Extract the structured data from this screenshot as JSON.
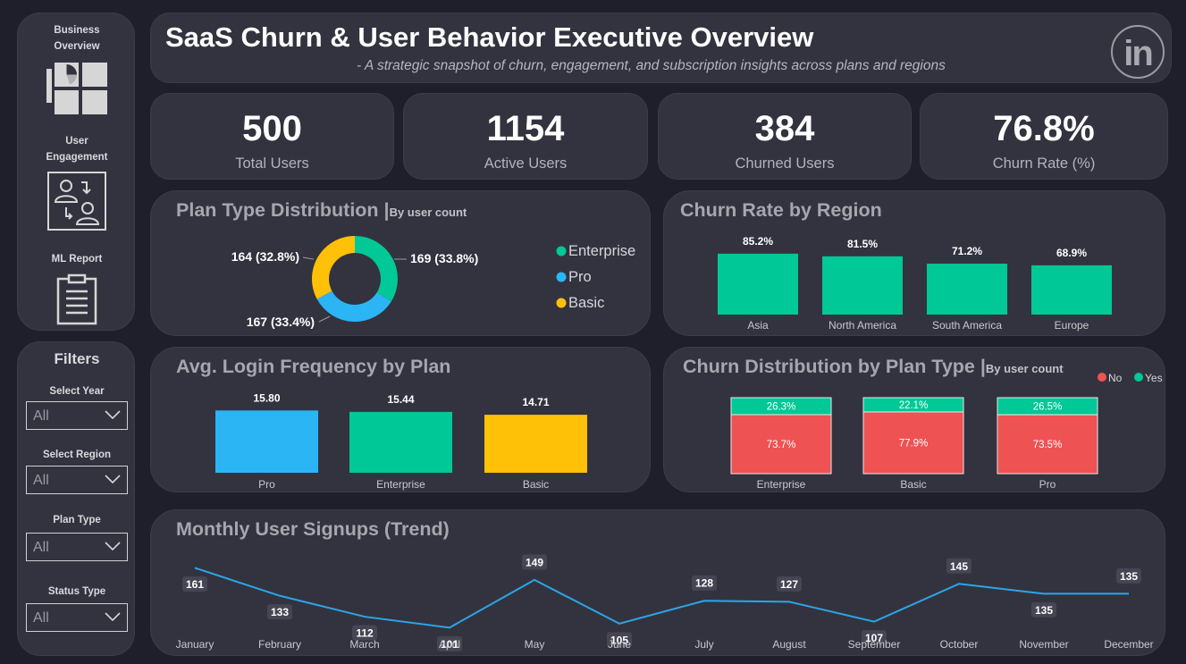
{
  "nav": {
    "items": [
      {
        "label_1": "Business",
        "label_2": "Overview",
        "icon": "dashboard-icon"
      },
      {
        "label_1": "User",
        "label_2": "Engagement",
        "icon": "users-icon"
      },
      {
        "label_1": "ML Report",
        "label_2": "",
        "icon": "clipboard-icon"
      }
    ]
  },
  "filters": {
    "title": "Filters",
    "items": [
      {
        "label": "Select Year",
        "value": "All"
      },
      {
        "label": "Select Region",
        "value": "All"
      },
      {
        "label": "Plan Type",
        "value": "All"
      },
      {
        "label": "Status Type",
        "value": "All"
      }
    ]
  },
  "header": {
    "title": "SaaS Churn & User Behavior Executive Overview",
    "subtitle": "- A strategic snapshot of churn, engagement, and subscription insights across plans and regions",
    "logo_text": "in"
  },
  "kpis": [
    {
      "value": "500",
      "label": "Total Users"
    },
    {
      "value": "1154",
      "label": "Active Users"
    },
    {
      "value": "384",
      "label": "Churned Users"
    },
    {
      "value": "76.8%",
      "label": "Churn Rate (%)"
    }
  ],
  "colors": {
    "green": "#00c896",
    "blue": "#2bb5f5",
    "yellow": "#ffc107",
    "red": "#ee5253",
    "line": "#2ba6e8"
  },
  "chart_data": [
    {
      "type": "pie",
      "title": "Plan Type Distribution",
      "subtitle": "By user count",
      "categories": [
        "Enterprise",
        "Pro",
        "Basic"
      ],
      "values": [
        169,
        167,
        164
      ],
      "labels": [
        "169 (33.8%)",
        "167 (33.4%)",
        "164 (32.8%)"
      ],
      "legend": "right"
    },
    {
      "type": "bar",
      "title": "Churn Rate by Region",
      "categories": [
        "Asia",
        "North America",
        "South America",
        "Europe"
      ],
      "values": [
        85.2,
        81.5,
        71.2,
        68.9
      ],
      "labels": [
        "85.2%",
        "81.5%",
        "71.2%",
        "68.9%"
      ],
      "ylim": [
        0,
        100
      ]
    },
    {
      "type": "bar",
      "title": "Avg. Login Frequency by Plan",
      "categories": [
        "Pro",
        "Enterprise",
        "Basic"
      ],
      "values": [
        15.8,
        15.44,
        14.71
      ],
      "labels": [
        "15.80",
        "15.44",
        "14.71"
      ],
      "colors": [
        "#2bb5f5",
        "#00c896",
        "#ffc107"
      ],
      "ylim": [
        0,
        17
      ]
    },
    {
      "type": "bar",
      "title": "Churn Distribution by Plan Type",
      "subtitle": "By user count",
      "stacked": true,
      "legend": "top-right",
      "categories": [
        "Enterprise",
        "Basic",
        "Pro"
      ],
      "series": [
        {
          "name": "No",
          "values": [
            73.7,
            77.9,
            73.5
          ],
          "labels": [
            "73.7%",
            "77.9%",
            "73.5%"
          ]
        },
        {
          "name": "Yes",
          "values": [
            26.3,
            22.1,
            26.5
          ],
          "labels": [
            "26.3%",
            "22.1%",
            "26.5%"
          ]
        }
      ]
    },
    {
      "type": "line",
      "title": "Monthly User Signups (Trend)",
      "categories": [
        "January",
        "February",
        "March",
        "April",
        "May",
        "June",
        "July",
        "August",
        "September",
        "October",
        "November",
        "December"
      ],
      "values": [
        161,
        133,
        112,
        101,
        149,
        105,
        128,
        127,
        107,
        145,
        135,
        135
      ],
      "ylim": [
        95,
        165
      ]
    }
  ]
}
